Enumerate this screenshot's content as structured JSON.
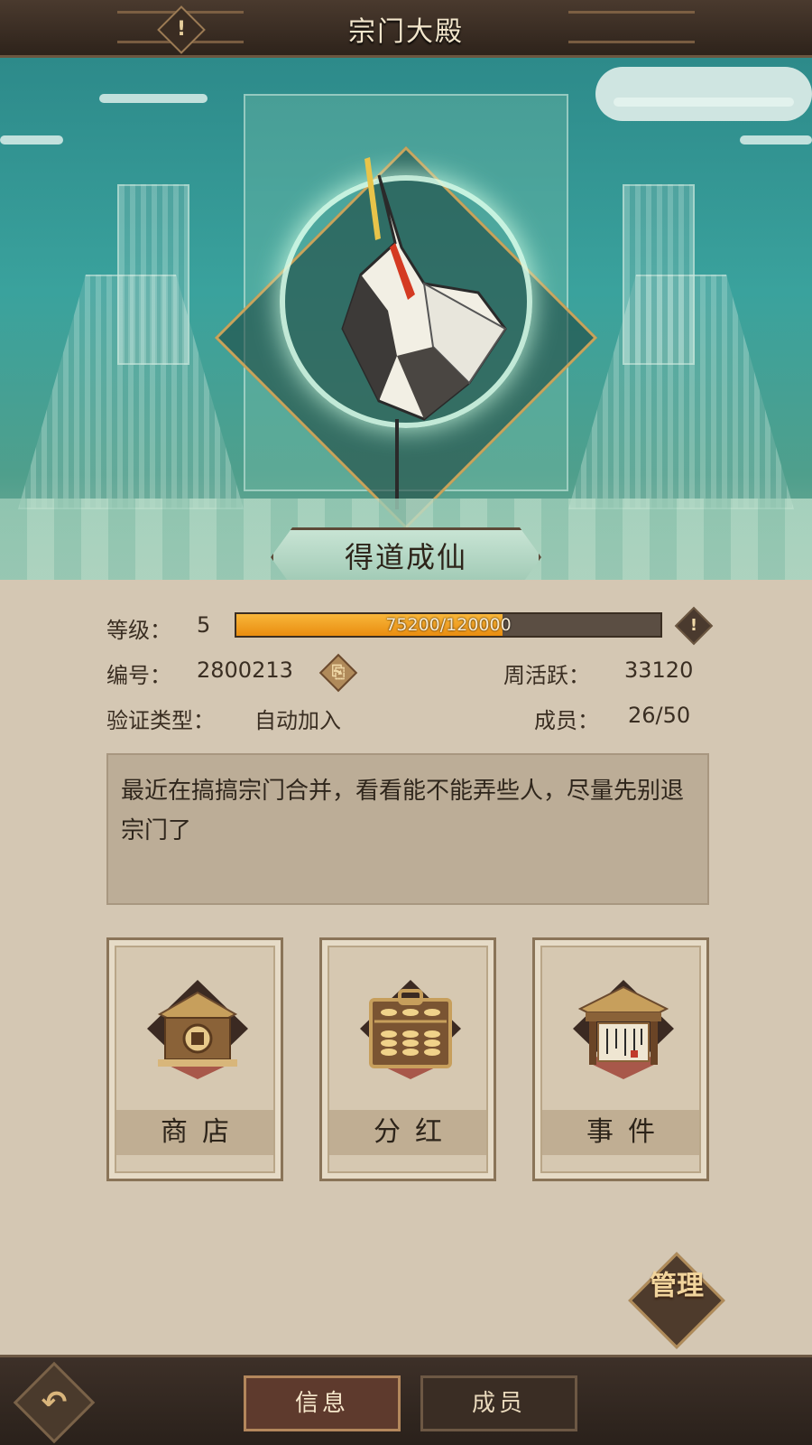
{
  "header": {
    "title": "宗门大殿",
    "info_icon": "!"
  },
  "banner": {
    "sect_name": "得道成仙"
  },
  "info": {
    "level_label": "等级：",
    "level_value": "5",
    "xp_text": "75200/120000",
    "xp_progress": 0.627,
    "id_label": "编号：",
    "id_value": "2800213",
    "weekly_label": "周活跃：",
    "weekly_value": "33120",
    "verify_label": "验证类型：",
    "verify_value": "自动加入",
    "members_label": "成员：",
    "members_value": "26/50"
  },
  "notice": "最近在搞搞宗门合并，看看能不能弄些人，尽量先别退宗门了",
  "cards": [
    {
      "label": "商店",
      "icon": "shop-icon"
    },
    {
      "label": "分红",
      "icon": "abacus-icon"
    },
    {
      "label": "事件",
      "icon": "event-scroll-icon"
    }
  ],
  "manage": {
    "label": "管理"
  },
  "footer": {
    "tabs": [
      {
        "label": "信息",
        "active": true
      },
      {
        "label": "成员",
        "active": false
      }
    ]
  },
  "colors": {
    "xp_fill": "#f0a020",
    "panel_bg": "#d4c7b3",
    "banner_teal": "#2d8a8a"
  }
}
